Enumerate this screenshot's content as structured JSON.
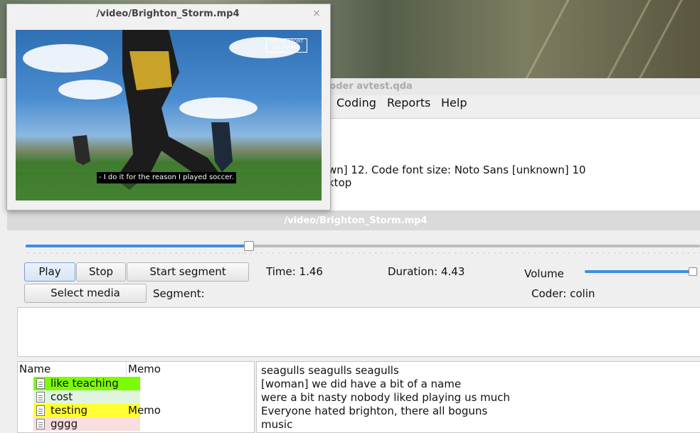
{
  "main_window": {
    "title": "QualCoder avtest.qda",
    "menu": [
      "Coding",
      "Reports",
      "Help"
    ],
    "info_lines": [
      "wn] 12. Code font size: Noto Sans [unknown] 10",
      "ktop"
    ]
  },
  "av_dialog": {
    "title": "/video/Brighton_Storm.mp4",
    "position_fraction": 0.33,
    "volume_fraction": 0.99,
    "buttons": {
      "play": "Play",
      "stop": "Stop",
      "start_segment": "Start segment",
      "select_media": "Select media"
    },
    "time_label": "Time: 1.46",
    "duration_label": "Duration: 4.43",
    "volume_label": "Volume",
    "segment_label": "Segment:",
    "coder_label": "Coder: colin"
  },
  "code_tree": {
    "headers": [
      "Name",
      "Memo"
    ],
    "rows": [
      {
        "name": "like teaching",
        "memo": "",
        "color": "#7cfc00"
      },
      {
        "name": "cost",
        "memo": "",
        "color": "#dff5df"
      },
      {
        "name": "testing",
        "memo": "Memo",
        "color": "#ffff33"
      },
      {
        "name": "gggg",
        "memo": "",
        "color": "#f8dede"
      }
    ]
  },
  "transcript": {
    "lines": [
      "seagulls seagulls seagulls",
      "[woman] we did have a bit of a name",
      "were a bit nasty nobody liked playing us much",
      "Everyone hated brighton, there all boguns",
      "music"
    ]
  },
  "video_window": {
    "title": "/video/Brighton_Storm.mp4",
    "close_glyph": "×",
    "watermark_line1": "OPTUS SPORT",
    "watermark_line2": "ORIGINALS",
    "subtitle": "- I do it for the reason I played soccer."
  }
}
